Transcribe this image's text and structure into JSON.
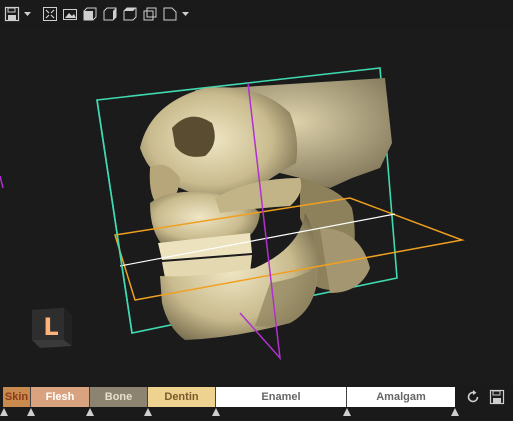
{
  "toolbar": {
    "buttons": [
      {
        "name": "save-view-icon"
      },
      {
        "name": "fit-view-icon"
      },
      {
        "name": "screenshot-icon"
      },
      {
        "name": "cube-front-icon"
      },
      {
        "name": "cube-side-icon"
      },
      {
        "name": "cube-top-icon"
      },
      {
        "name": "cube-outline-icon"
      },
      {
        "name": "page-icon"
      }
    ]
  },
  "orientation": {
    "label": "L"
  },
  "transfer_function": {
    "segments": [
      {
        "label": "Skin",
        "color": "#c98a4e",
        "text_color": "#8a3b18"
      },
      {
        "label": "Flesh",
        "color": "#d9a37f",
        "text_color": "#ffffff"
      },
      {
        "label": "Bone",
        "color": "#8c8370",
        "text_color": "#e8e0cc"
      },
      {
        "label": "Dentin",
        "color": "#eed28f",
        "text_color": "#7a5a2a"
      },
      {
        "label": "Enamel",
        "color": "#ffffff",
        "text_color": "#666666"
      },
      {
        "label": "Amalgam",
        "color": "#ffffff",
        "text_color": "#666666"
      }
    ]
  },
  "colors": {
    "axial_plane": "#f0a020",
    "bounding_box": "#3fdab0",
    "sagittal_plane": "#b030d0",
    "bone_base": "#cfc29a"
  }
}
